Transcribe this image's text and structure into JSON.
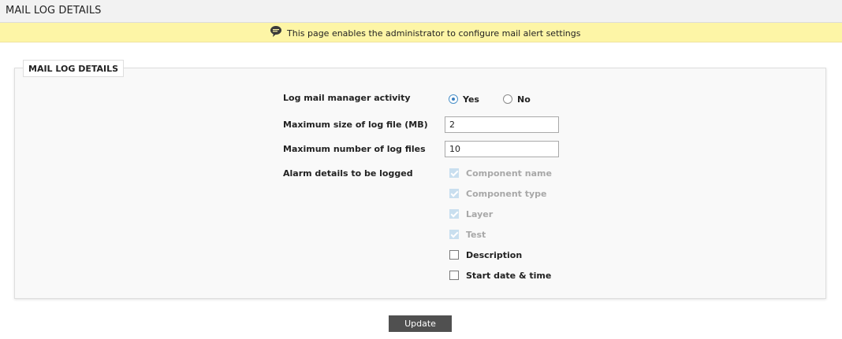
{
  "header": {
    "title": "MAIL LOG DETAILS"
  },
  "banner": {
    "icon": "speech-bubble-icon",
    "text": "This page enables the administrator to configure mail alert settings"
  },
  "panel": {
    "legend": "MAIL LOG DETAILS",
    "log_activity": {
      "label": "Log mail manager activity",
      "options": [
        {
          "label": "Yes",
          "selected": true
        },
        {
          "label": "No",
          "selected": false
        }
      ]
    },
    "max_size": {
      "label": "Maximum size of log file (MB)",
      "value": "2"
    },
    "max_files": {
      "label": "Maximum number of log files",
      "value": "10"
    },
    "alarm_details": {
      "label": "Alarm details to be logged",
      "items": [
        {
          "label": "Component name",
          "checked": true,
          "disabled": true
        },
        {
          "label": "Component type",
          "checked": true,
          "disabled": true
        },
        {
          "label": "Layer",
          "checked": true,
          "disabled": true
        },
        {
          "label": "Test",
          "checked": true,
          "disabled": true
        },
        {
          "label": "Description",
          "checked": false,
          "disabled": false
        },
        {
          "label": "Start date & time",
          "checked": false,
          "disabled": false
        }
      ]
    }
  },
  "actions": {
    "update_label": "Update"
  },
  "colors": {
    "banner_bg": "#fdf5a6",
    "button_bg": "#505050",
    "disabled_check": "#c9dfef",
    "radio_accent": "#3a7fc0"
  }
}
